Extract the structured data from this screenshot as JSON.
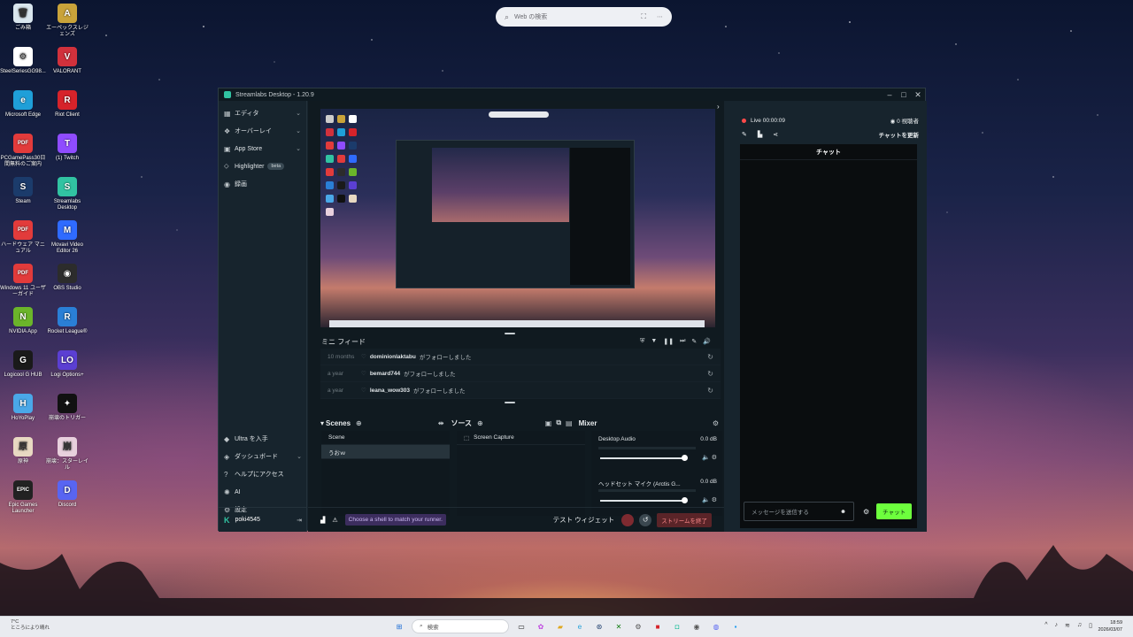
{
  "web_search": {
    "placeholder": "Web の検索"
  },
  "desktop_icons": [
    {
      "label": "ごみ箱",
      "color": "#d9e6ee",
      "glyph": "🗑"
    },
    {
      "label": "エーペックスレジェンズ",
      "color": "#c9a33a",
      "glyph": "A"
    },
    {
      "label": "SteelSeriesGG98...",
      "color": "#ffffff",
      "glyph": "⚙"
    },
    {
      "label": "VALORANT",
      "color": "#d1313c",
      "glyph": "V"
    },
    {
      "label": "Microsoft Edge",
      "color": "#1f9fd8",
      "glyph": "e"
    },
    {
      "label": "Riot Client",
      "color": "#d6232a",
      "glyph": "R"
    },
    {
      "label": "PCGamePass30日間無料のご案内",
      "color": "#e23b3b",
      "glyph": "PDF"
    },
    {
      "label": "(1) Twitch",
      "color": "#8f4cff",
      "glyph": "T"
    },
    {
      "label": "Steam",
      "color": "#1b3b6b",
      "glyph": "S"
    },
    {
      "label": "Streamlabs Desktop",
      "color": "#31c3a2",
      "glyph": "S"
    },
    {
      "label": "ハードウェア マニュアル",
      "color": "#e23b3b",
      "glyph": "PDF"
    },
    {
      "label": "Movavi Video Editor 26",
      "color": "#2f6bff",
      "glyph": "M"
    },
    {
      "label": "Windows 11 ユーザーガイド",
      "color": "#e23b3b",
      "glyph": "PDF"
    },
    {
      "label": "OBS Studio",
      "color": "#2c2c2c",
      "glyph": "◉"
    },
    {
      "label": "NVIDIA App",
      "color": "#6bb52a",
      "glyph": "N"
    },
    {
      "label": "Rocket League®",
      "color": "#2a7fd6",
      "glyph": "R"
    },
    {
      "label": "Logicool G HUB",
      "color": "#1a1a1a",
      "glyph": "G"
    },
    {
      "label": "Logi Options+",
      "color": "#5b3fd3",
      "glyph": "LO"
    },
    {
      "label": "HoYoPlay",
      "color": "#4aa8e8",
      "glyph": "H"
    },
    {
      "label": "崩壊のトリガー",
      "color": "#111111",
      "glyph": "✦"
    },
    {
      "label": "原神",
      "color": "#e8d9c2",
      "glyph": "原"
    },
    {
      "label": "崩壊：スターレイル",
      "color": "#e8d0dd",
      "glyph": "崩"
    },
    {
      "label": "Epic Games Launcher",
      "color": "#222222",
      "glyph": "EPIC"
    },
    {
      "label": "Discord",
      "color": "#5865f2",
      "glyph": "D"
    }
  ],
  "window": {
    "title": "Streamlabs Desktop - 1.20.9",
    "controls": [
      "–",
      "□",
      "✕"
    ]
  },
  "sidebar": {
    "items": [
      {
        "label": "エディタ",
        "icon": "grid-icon",
        "glyph": "▦",
        "chevron": true
      },
      {
        "label": "オーバーレイ",
        "icon": "overlay-icon",
        "glyph": "❖",
        "chevron": true
      },
      {
        "label": "App Store",
        "icon": "store-icon",
        "glyph": "▣",
        "chevron": true
      },
      {
        "label": "Highlighter",
        "icon": "highlighter-icon",
        "glyph": "⬦",
        "badge": "beta"
      },
      {
        "label": "録画",
        "icon": "record-icon",
        "glyph": "◉"
      }
    ],
    "bottom_items": [
      {
        "label": "Ultra を入手",
        "icon": "ultra-icon",
        "glyph": "◆"
      },
      {
        "label": "ダッシュボード",
        "icon": "dashboard-icon",
        "glyph": "◈",
        "chevron": true
      },
      {
        "label": "ヘルプにアクセス",
        "icon": "help-icon",
        "glyph": "?"
      },
      {
        "label": "AI",
        "icon": "ai-icon",
        "glyph": "✺"
      },
      {
        "label": "設定",
        "icon": "settings-icon",
        "glyph": "⚙"
      }
    ],
    "user": "poki4545"
  },
  "minifeed": {
    "title": "ミニ フィード",
    "rows": [
      {
        "time": "10 months",
        "name": "dominionlaktabu",
        "action": "がフォローしました"
      },
      {
        "time": "a year",
        "name": "bemard744",
        "action": "がフォローしました"
      },
      {
        "time": "a year",
        "name": "leana_wow303",
        "action": "がフォローしました"
      }
    ]
  },
  "scenes": {
    "title": "Scenes",
    "header": "Scene",
    "items": [
      "うおｗ"
    ]
  },
  "sources": {
    "title": "ソース",
    "items": [
      "Screen Capture"
    ]
  },
  "mixer": {
    "title": "Mixer",
    "channels": [
      {
        "name": "Desktop Audio",
        "db": "0.0 dB",
        "level": 0.85
      },
      {
        "name": "ヘッドセット マイク (Arctis G...",
        "db": "0.0 dB",
        "level": 0.85
      }
    ]
  },
  "footer": {
    "promo": "Choose a shell to match your runner.",
    "test_widget": "テスト ウィジェット",
    "stop_stream": "ストリームを終了"
  },
  "right_panel": {
    "live": "Live 00:00:09",
    "viewers": "0 視聴者",
    "refresh_chat": "チャットを更新",
    "chat_title": "チャット",
    "chat_placeholder": "メッセージを送信する",
    "chat_button": "チャット"
  },
  "taskbar": {
    "weather": [
      "7°C",
      "ところにより晴れ"
    ],
    "search_placeholder": "検索",
    "time": "18:59",
    "date": "2026/03/07"
  }
}
